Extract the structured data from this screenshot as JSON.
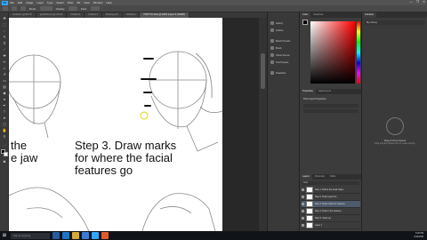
{
  "menubar": {
    "logo": "Ps",
    "items": [
      "File",
      "Edit",
      "Image",
      "Layer",
      "Type",
      "Select",
      "Filter",
      "3D",
      "View",
      "Window",
      "Help"
    ],
    "win_buttons": [
      "—",
      "❐",
      "✕"
    ]
  },
  "options": {
    "label_mode": "Mode:",
    "label_opacity": "Opacity:",
    "label_flow": "Flow:"
  },
  "tabs": [
    "Untitled-1 @ 66.7%",
    "guideline.psd @ 33.3%",
    "Untitled-2",
    "Untitled-3",
    "Drawing.psd",
    "Untitled-4",
    "HOW TO draw @ 100% (Layer 8, RGB/8)"
  ],
  "canvas_text": {
    "left_line1": "the",
    "left_line2": "e jaw",
    "step_line1": "Step 3. Draw marks",
    "step_line2": "for where the facial",
    "step_line3": "features go"
  },
  "midpanel": {
    "items": [
      "History",
      "Actions",
      "Brush Presets",
      "Brush",
      "Clone Source",
      "Tool Presets",
      "Swatches"
    ]
  },
  "color_panel": {
    "tabs": [
      "Color",
      "Swatches"
    ]
  },
  "properties_panel": {
    "tabs": [
      "Properties",
      "Adjustments"
    ],
    "title": "Pixel Layer Properties"
  },
  "layers_panel": {
    "tabs": [
      "Layers",
      "Channels",
      "Paths"
    ],
    "kind_label": "Kind",
    "layers": [
      "Step 1. Define the head shape",
      "Step 2. Draw a jaw line",
      "Step 3. Draw marks for features",
      "Step 4. Draw in the features",
      "Step 5. Clean up",
      "Layer 1"
    ]
  },
  "libraries_panel": {
    "tab": "Libraries",
    "library_name": "My Library",
    "empty_title": "Drag & Drop Assets",
    "empty_text": "Drag and drop assets here to create a library"
  },
  "taskbar": {
    "search_placeholder": "Ask me anything",
    "time": "5:20 PM",
    "date": "5/16/2016"
  }
}
